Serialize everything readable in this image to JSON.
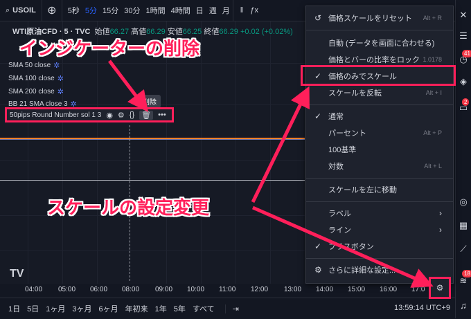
{
  "topbar": {
    "symbol": "USOIL",
    "timeframes": [
      "5秒",
      "5分",
      "15分",
      "30分",
      "1時間",
      "4時間",
      "日",
      "週",
      "月"
    ],
    "active_timeframe": "5分"
  },
  "chart": {
    "title": "WTI原油CFD · 5 · TVC",
    "ohlc": [
      {
        "label": "始値",
        "value": "66.27"
      },
      {
        "label": "高値",
        "value": "66.29"
      },
      {
        "label": "安値",
        "value": "66.25"
      },
      {
        "label": "終値",
        "value": "66.29"
      }
    ],
    "change": "+0.02 (+0.02%)",
    "indicators": [
      "SMA 50 close",
      "SMA 100 close",
      "SMA 200 close",
      "BB 21 SMA close 3"
    ],
    "selected_indicator": "50pips Round Number sol 1 3",
    "tooltip": "削除"
  },
  "annotations": {
    "title1": "インジケーターの削除",
    "title2": "スケールの設定変更"
  },
  "menu": {
    "items": [
      {
        "label": "価格スケールをリセット",
        "shortcut": "Alt + R"
      },
      {
        "label": "自動 (データを画面に合わせる)",
        "shortcut": ""
      },
      {
        "label": "価格とバーの比率をロック",
        "shortcut": "1.0178"
      },
      {
        "label": "価格のみでスケール",
        "shortcut": ""
      },
      {
        "label": "スケールを反転",
        "shortcut": "Alt + I"
      },
      {
        "label": "通常",
        "shortcut": ""
      },
      {
        "label": "パーセント",
        "shortcut": "Alt + P"
      },
      {
        "label": "100基準",
        "shortcut": ""
      },
      {
        "label": "対数",
        "shortcut": "Alt + L"
      },
      {
        "label": "スケールを左に移動",
        "shortcut": ""
      },
      {
        "label": "ラベル",
        "shortcut": ""
      },
      {
        "label": "ライン",
        "shortcut": ""
      },
      {
        "label": "プラスボタン",
        "shortcut": ""
      },
      {
        "label": "さらに詳細な設定...",
        "shortcut": ""
      }
    ]
  },
  "timeaxis": {
    "labels": [
      "04:00",
      "05:00",
      "06:00",
      "08:00",
      "09:00",
      "10:00",
      "11:00",
      "12:00",
      "13:00",
      "14:00",
      "15:00",
      "16:00",
      "17:0"
    ]
  },
  "bottombar": {
    "ranges": [
      "1日",
      "5日",
      "1ヶ月",
      "3ヶ月",
      "6ヶ月",
      "年初来",
      "1年",
      "5年",
      "すべて"
    ],
    "clock": "13:59:14 UTC+9"
  },
  "sidebar": {
    "badges": [
      "41",
      "2",
      "18"
    ]
  }
}
